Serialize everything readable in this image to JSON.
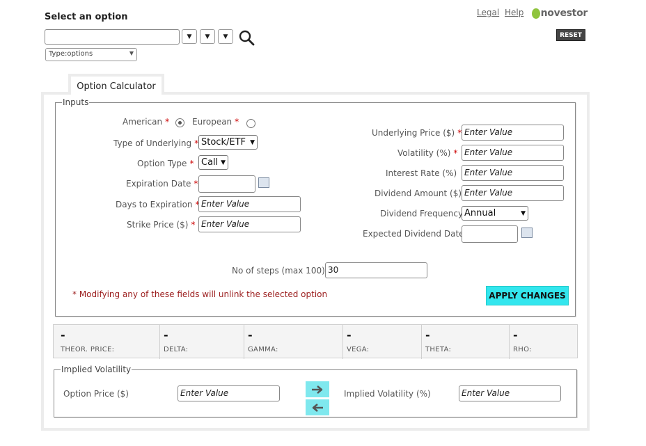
{
  "header": {
    "select_title": "Select an option",
    "type_select": "Type:options",
    "links": {
      "legal": "Legal",
      "help": "Help"
    },
    "logo_text": "novestor",
    "reset_label": "RESET"
  },
  "tab": {
    "label": "Option Calculator"
  },
  "inputs": {
    "legend": "Inputs",
    "style": {
      "american": "American",
      "european": "European",
      "selected": "American"
    },
    "left": {
      "type_of_underlying": {
        "label": "Type of Underlying",
        "value": "Stock/ETF"
      },
      "option_type": {
        "label": "Option Type",
        "value": "Call"
      },
      "expiration_date": {
        "label": "Expiration Date",
        "value": ""
      },
      "days_to_expiration": {
        "label": "Days to Expiration",
        "placeholder": "Enter Value"
      },
      "strike_price": {
        "label": "Strike Price ($)",
        "placeholder": "Enter Value"
      }
    },
    "right": {
      "underlying_price": {
        "label": "Underlying Price ($)",
        "placeholder": "Enter Value"
      },
      "volatility": {
        "label": "Volatility (%)",
        "placeholder": "Enter Value"
      },
      "interest_rate": {
        "label": "Interest Rate (%)",
        "placeholder": "Enter Value"
      },
      "dividend_amount": {
        "label": "Dividend Amount ($)",
        "placeholder": "Enter Value"
      },
      "dividend_frequency": {
        "label": "Dividend Frequency",
        "value": "Annual"
      },
      "expected_dividend_date": {
        "label": "Expected Dividend Date",
        "value": ""
      }
    },
    "steps": {
      "label": "No of steps (max 100)",
      "value": "30"
    },
    "note": "* Modifying any of these fields will unlink the selected option",
    "apply_label": "APPLY CHANGES",
    "required_mark": "*"
  },
  "greeks": [
    {
      "value": "-",
      "label": "THEOR. PRICE:"
    },
    {
      "value": "-",
      "label": "DELTA:"
    },
    {
      "value": "-",
      "label": "GAMMA:"
    },
    {
      "value": "-",
      "label": "VEGA:"
    },
    {
      "value": "-",
      "label": "THETA:"
    },
    {
      "value": "-",
      "label": "RHO:"
    }
  ],
  "implied_volatility": {
    "legend": "Implied Volatility",
    "option_price": {
      "label": "Option Price ($)",
      "placeholder": "Enter Value"
    },
    "implied_vol": {
      "label": "Implied Volatility (%)",
      "placeholder": "Enter Value"
    }
  },
  "icons": {
    "search": "search-icon",
    "calendar": "calendar-icon",
    "arrow_right": "arrow-right-icon",
    "arrow_left": "arrow-left-icon"
  },
  "colors": {
    "apply_button": "#33e6ee",
    "arrow_buttons": "#7fe8ee",
    "required": "#cc0000",
    "note": "#9b1d1d",
    "logo": "#8fc43e"
  }
}
